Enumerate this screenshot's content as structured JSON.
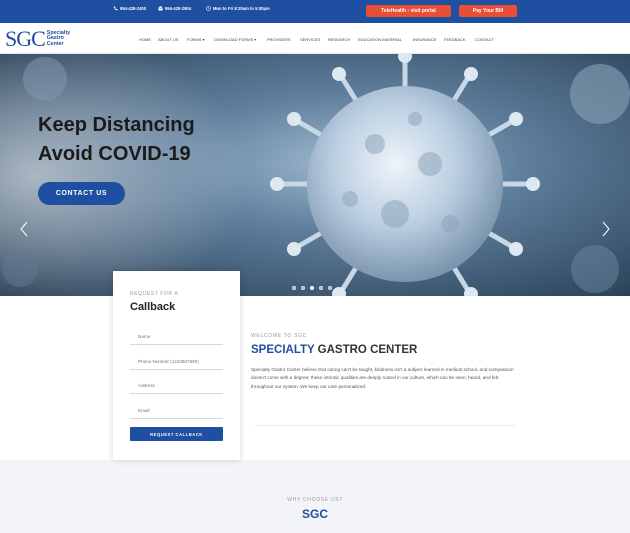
{
  "topbar": {
    "phone": "954-428-2400",
    "fax": "954-428-2904",
    "hours": "Mon to Fri 8:30am to 5:00pm",
    "telehealth_label": "TeleHealth - visit portal",
    "paybill_label": "Pay Your Bill",
    "accent_color": "#e94f37",
    "bar_color": "#1e4fa0"
  },
  "logo": {
    "mark": "SGC",
    "line1": "Specialty",
    "line2": "Gastro",
    "line3": "Center"
  },
  "nav": {
    "items": [
      {
        "label": "HOME"
      },
      {
        "label": "ABOUT US"
      },
      {
        "label": "FORMS ▾"
      },
      {
        "label": "DOWNLOAD FORMS ▾"
      },
      {
        "label": "PROVIDERS"
      },
      {
        "label": "SERVICES"
      },
      {
        "label": "RESEARCH"
      },
      {
        "label": "EDUCATION MATERIAL"
      },
      {
        "label": "INSURANCE"
      },
      {
        "label": "FEEDBACK"
      },
      {
        "label": "CONTACT"
      }
    ]
  },
  "hero": {
    "title": "Keep Distancing\nAvoid COVID-19",
    "button_label": "CONTACT US",
    "prev_icon": "chevron-left-icon",
    "next_icon": "chevron-right-icon",
    "slide_count": 5,
    "active_slide": 3
  },
  "callback": {
    "pretitle": "REQUEST FOR A",
    "title": "Callback",
    "name_placeholder": "Name",
    "phone_placeholder": "Phone Number (1234567890)",
    "address_placeholder": "Address",
    "email_placeholder": "Email",
    "button_label": "REQUEST CALLBACK"
  },
  "welcome": {
    "pretitle": "WELCOME TO SGC",
    "title_blue": "SPECIALTY",
    "title_rest": " GASTRO CENTER",
    "body": "Specialty Gastro Center believe that caring can't be taught, kindness isn't a subject learned in medical school, and compassion doesn't come with a degree; these intrinsic qualities are deeply rooted in our culture, which can be seen, heard, and felt throughout our system. We keep our care personalized."
  },
  "why": {
    "pretitle": "WHY CHOOSE US?",
    "title": "SGC"
  }
}
